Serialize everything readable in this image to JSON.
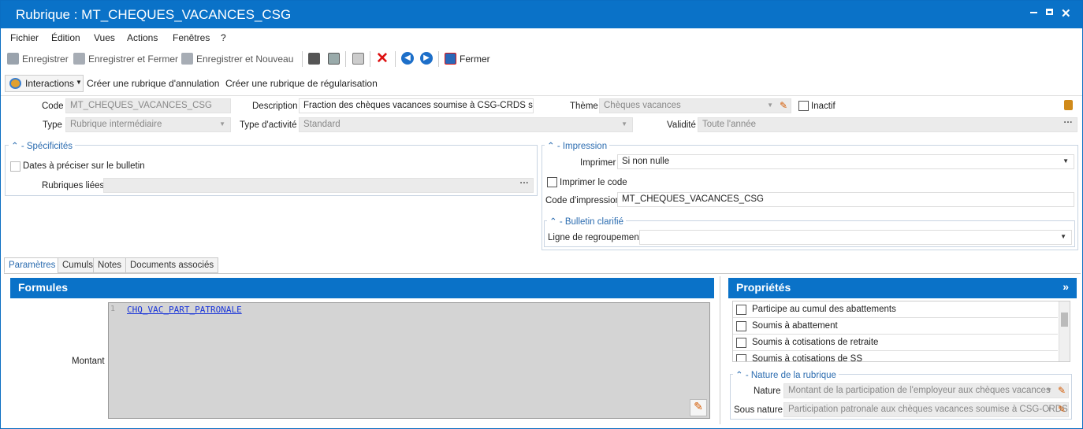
{
  "window": {
    "title": "Rubrique : MT_CHEQUES_VACANCES_CSG"
  },
  "menu": [
    "Fichier",
    "Édition",
    "Vues",
    "Actions",
    "Fenêtres",
    "?"
  ],
  "toolbar": {
    "save": "Enregistrer",
    "save_close": "Enregistrer et Fermer",
    "save_new": "Enregistrer et Nouveau",
    "close": "Fermer"
  },
  "actionbar": {
    "interactions": "Interactions",
    "create_cancel": "Créer une rubrique d'annulation",
    "create_regul": "Créer une rubrique de régularisation"
  },
  "form": {
    "code_label": "Code",
    "code": "MT_CHEQUES_VACANCES_CSG",
    "description_label": "Description",
    "description": "Fraction des chèques vacances soumise à CSG-CRDS sans al",
    "theme_label": "Thème",
    "theme": "Chèques vacances",
    "inactive_label": "Inactif",
    "type_label": "Type",
    "type": "Rubrique intermédiaire",
    "activity_label": "Type d'activité",
    "activity": "Standard",
    "validity_label": "Validité",
    "validity": "Toute l'année"
  },
  "specificities": {
    "title": "Spécificités",
    "dates_label": "Dates à préciser sur le bulletin",
    "linked_label": "Rubriques liées"
  },
  "impression": {
    "title": "Impression",
    "print_label": "Imprimer",
    "print_value": "Si non nulle",
    "print_code_label": "Imprimer le code",
    "code_label": "Code d'impression",
    "code_value": "MT_CHEQUES_VACANCES_CSG",
    "bulletin_title": "Bulletin clarifié",
    "group_label": "Ligne de regroupement"
  },
  "tabs": [
    "Paramètres",
    "Cumuls",
    "Notes",
    "Documents associés"
  ],
  "formulas": {
    "title": "Formules",
    "amount_label": "Montant",
    "line_number": "1",
    "code": "CHQ_VAC_PART_PATRONALE"
  },
  "properties": {
    "title": "Propriétés",
    "items": [
      "Participe au cumul des abattements",
      "Soumis à abattement",
      "Soumis à cotisations de retraite",
      "Soumis à cotisations de SS"
    ],
    "nature_title": "Nature de la rubrique",
    "nature_label": "Nature",
    "nature_value": "Montant de la participation de l'employeur aux chèques vacances",
    "subnature_label": "Sous nature",
    "subnature_value": "Participation patronale aux chèques vacances soumise à CSG-CRDS"
  }
}
